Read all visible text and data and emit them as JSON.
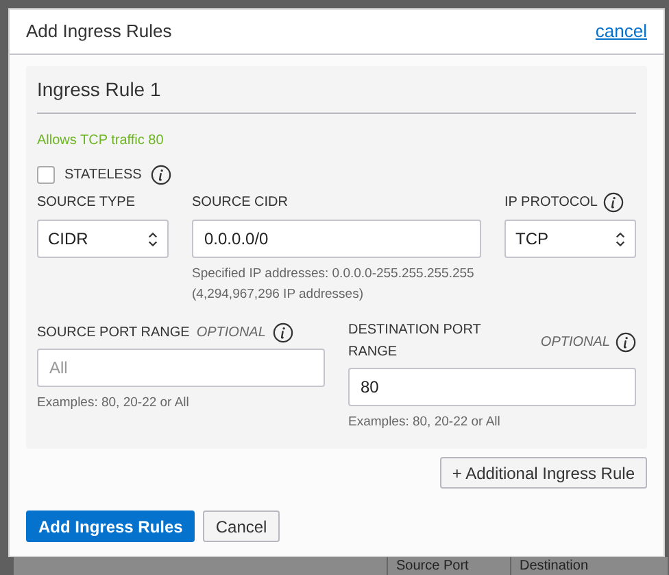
{
  "dialog": {
    "title": "Add Ingress Rules",
    "cancel_link": "cancel"
  },
  "rules": [
    {
      "title": "Ingress Rule 1",
      "summary": "Allows TCP traffic 80",
      "stateless": {
        "label": "STATELESS",
        "checked": false
      },
      "source_type": {
        "label": "SOURCE TYPE",
        "value": "CIDR"
      },
      "source_cidr": {
        "label": "SOURCE CIDR",
        "value": "0.0.0.0/0",
        "help": "Specified IP addresses: 0.0.0.0-255.255.255.255 (4,294,967,296 IP addresses)"
      },
      "ip_protocol": {
        "label": "IP PROTOCOL",
        "value": "TCP"
      },
      "source_port_range": {
        "label": "SOURCE PORT RANGE",
        "optional": "OPTIONAL",
        "placeholder": "All",
        "help": "Examples: 80, 20-22 or All"
      },
      "destination_port_range": {
        "label": "DESTINATION PORT RANGE",
        "optional": "OPTIONAL",
        "value": "80",
        "help": "Examples: 80, 20-22 or All"
      }
    }
  ],
  "additional_rule_button": "+ Additional Ingress Rule",
  "buttons": [
    {
      "label": "Add Ingress Rules",
      "kind": "primary"
    },
    {
      "label": "Cancel",
      "kind": "secondary"
    }
  ],
  "background_table": {
    "columns": [
      "Source Port",
      "Destination"
    ]
  }
}
